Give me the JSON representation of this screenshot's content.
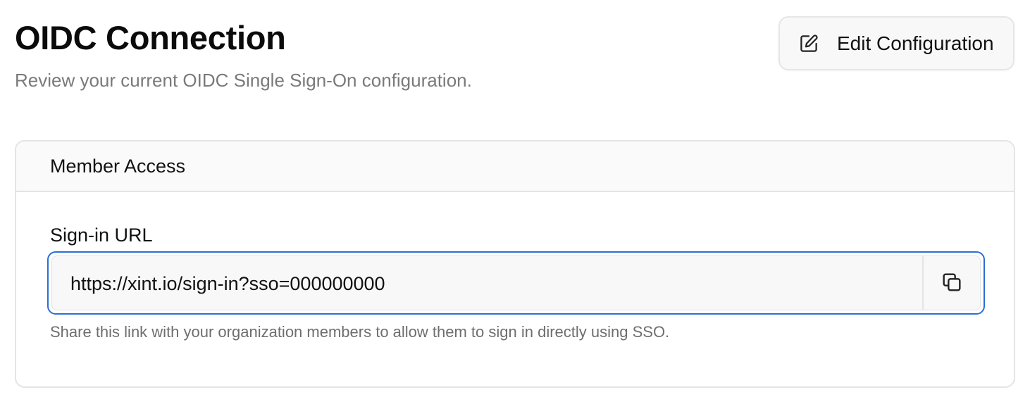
{
  "header": {
    "title": "OIDC Connection",
    "subtitle": "Review your current OIDC Single Sign-On configuration.",
    "edit_button": {
      "label": "Edit Configuration",
      "icon": "edit-icon"
    }
  },
  "card": {
    "title": "Member Access",
    "sign_in_url": {
      "label": "Sign-in URL",
      "value": "https://xint.io/sign-in?sso=000000000",
      "copy_icon": "copy-icon",
      "helper": "Share this link with your organization members to allow them to sign in directly using SSO."
    }
  },
  "colors": {
    "focus_ring": "#2a6fd6",
    "subtitle_text": "#7a7a7a",
    "border": "#e4e4e4"
  }
}
